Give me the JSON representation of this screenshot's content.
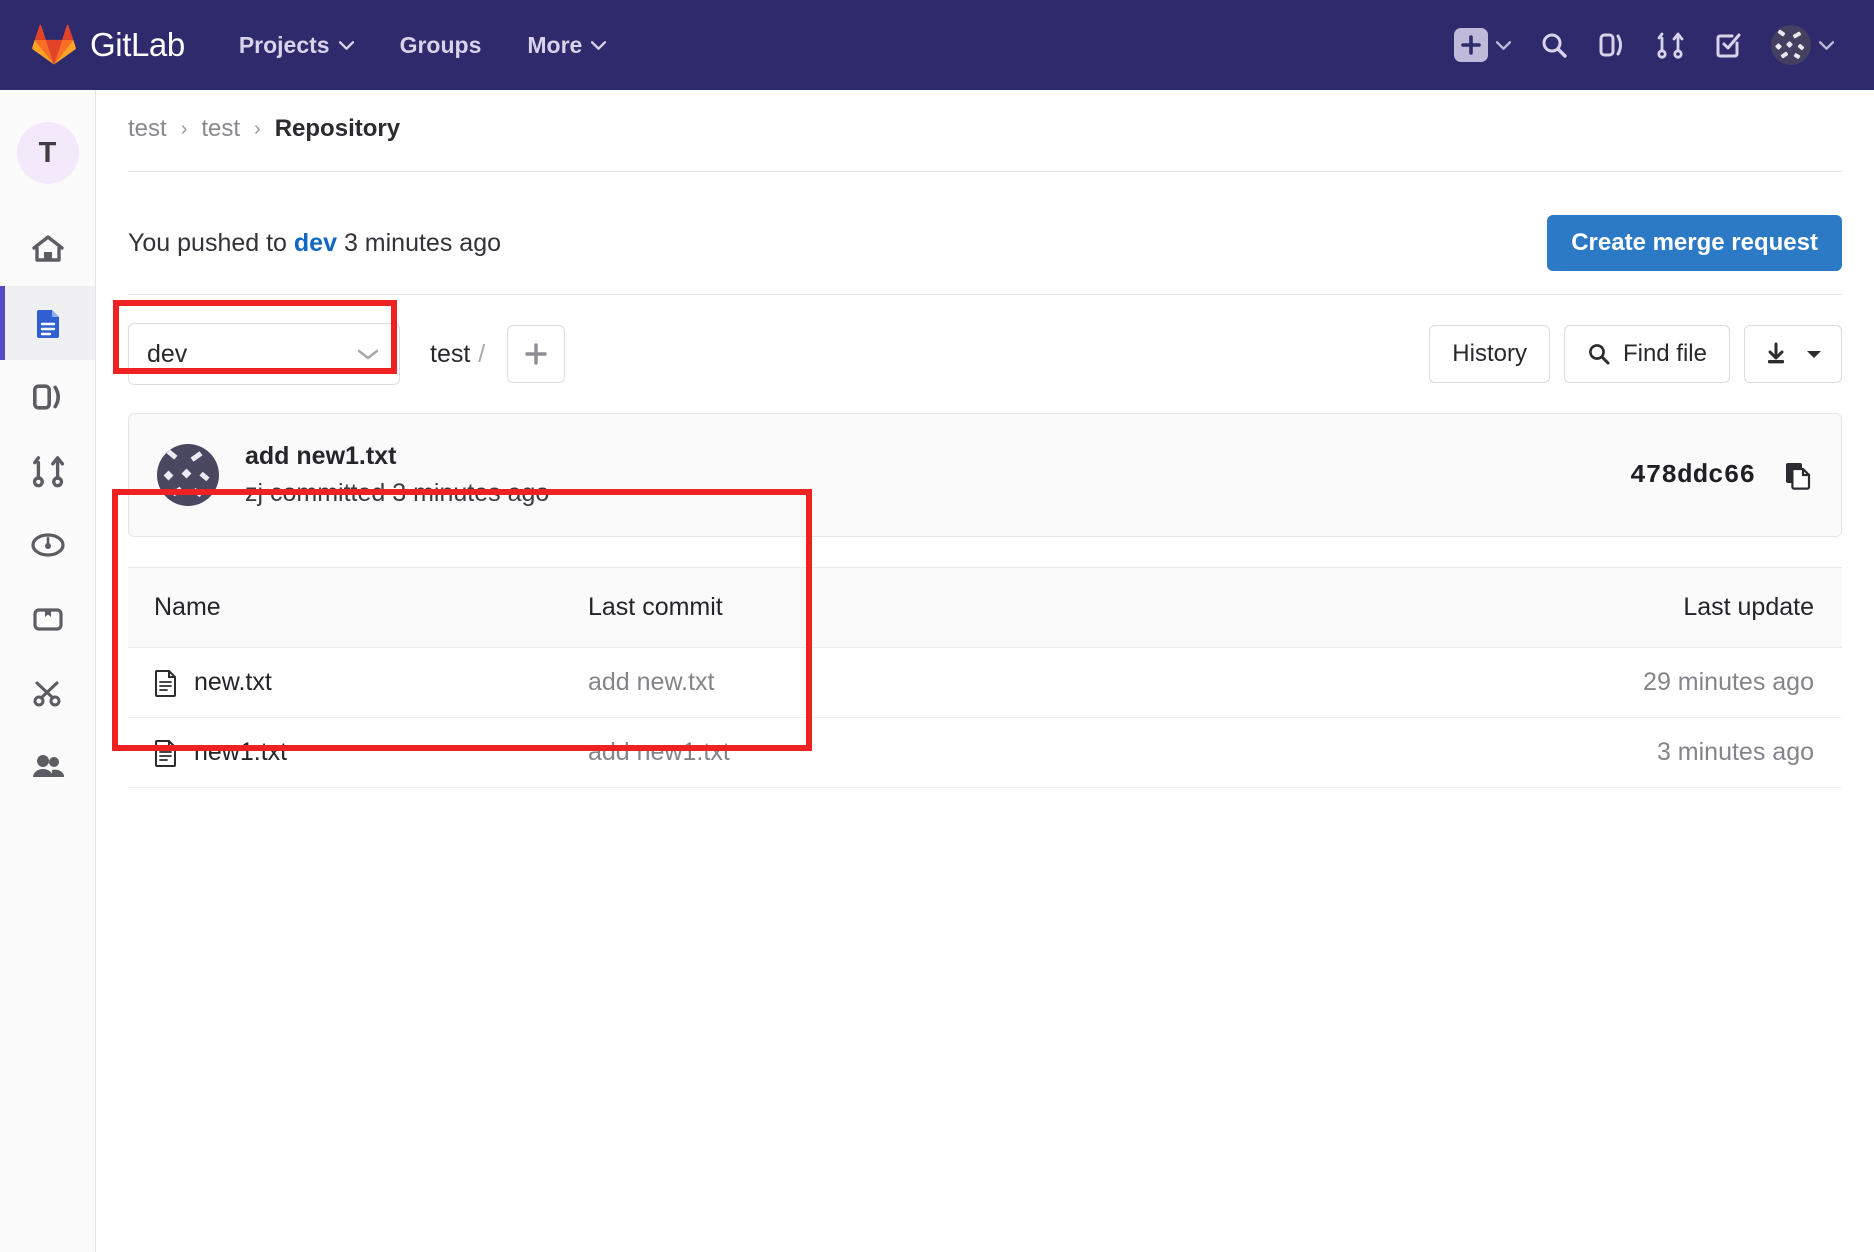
{
  "navbar": {
    "brand": "GitLab",
    "links": [
      {
        "label": "Projects",
        "icon": "chevron-down-icon"
      },
      {
        "label": "Groups",
        "icon": ""
      },
      {
        "label": "More",
        "icon": "chevron-down-icon"
      }
    ],
    "icons": [
      "plus-icon",
      "search-icon",
      "issues-icon",
      "merge-requests-icon",
      "todos-icon",
      "user-avatar"
    ],
    "brand_bg": "#2f2a6b"
  },
  "sidebar": {
    "project_initial": "T",
    "items": [
      {
        "name": "home-icon",
        "active": false
      },
      {
        "name": "repository-icon",
        "active": true
      },
      {
        "name": "issues-icon",
        "active": false
      },
      {
        "name": "merge-requests-icon",
        "active": false
      },
      {
        "name": "cicd-icon",
        "active": false
      },
      {
        "name": "packages-icon",
        "active": false
      },
      {
        "name": "snippets-icon",
        "active": false
      },
      {
        "name": "members-icon",
        "active": false
      }
    ]
  },
  "breadcrumb": {
    "items": [
      "test",
      "test"
    ],
    "current": "Repository",
    "separator": "›"
  },
  "push_banner": {
    "prefix": "You pushed to",
    "branch": "dev",
    "suffix": "3 minutes ago",
    "button": "Create merge request",
    "button_color": "#2c7ac6"
  },
  "toolbar": {
    "branch": "dev",
    "path_root": "test",
    "path_separator": "/",
    "add_label": "+",
    "history_label": "History",
    "find_file_label": "Find file",
    "download_label": "download-icon"
  },
  "commit": {
    "title": "add new1.txt",
    "author": "zj",
    "subtitle": "zj committed 3 minutes ago",
    "sha": "478ddc66",
    "copy_icon": "copy-icon"
  },
  "files": {
    "headers": {
      "name": "Name",
      "last_commit": "Last commit",
      "last_update": "Last update"
    },
    "rows": [
      {
        "icon": "file-icon",
        "name": "new.txt",
        "last_commit": "add new.txt",
        "last_update": "29 minutes ago"
      },
      {
        "icon": "file-icon",
        "name": "new1.txt",
        "last_commit": "add new1.txt",
        "last_update": "3 minutes ago"
      }
    ]
  },
  "annotations": {
    "highlight_color": "#ee2222",
    "boxes": [
      "branch-selector-highlight",
      "file-table-highlight"
    ]
  }
}
